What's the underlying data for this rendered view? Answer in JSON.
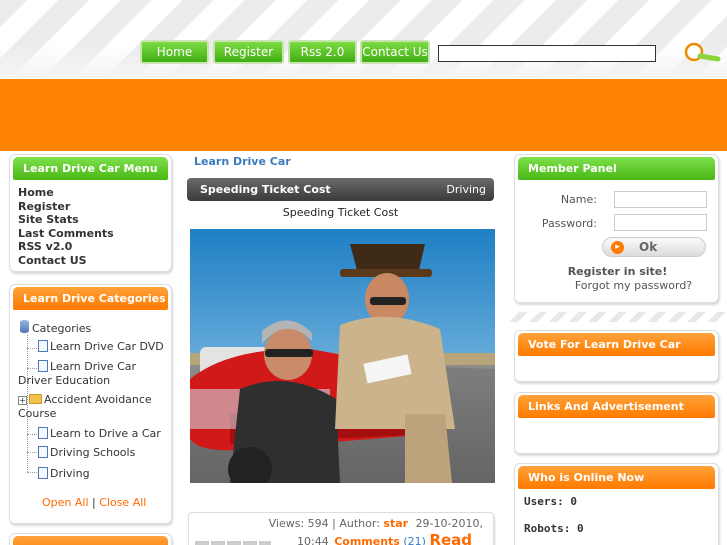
{
  "nav": {
    "home": "Home",
    "register": "Register",
    "rss": "Rss 2.0",
    "contact": "Contact Us",
    "search_value": ""
  },
  "left": {
    "menu_title": "Learn Drive Car Menu",
    "menu_items": [
      "Home",
      "Register",
      "Site Stats",
      "Last Comments",
      "RSS v2.0",
      "Contact US"
    ],
    "cat_title": "Learn Drive Categories",
    "tree_root": "Categories",
    "tree": {
      "dvd": "Learn Drive Car DVD",
      "edu_a": "Learn Drive Car",
      "edu_b": "Driver Education",
      "acc_a": "Accident Avoidance",
      "acc_b": "Course",
      "learn": "Learn to Drive a Car",
      "schools": "Driving Schools",
      "driving": "Driving"
    },
    "open_all": "Open All",
    "sep": "|",
    "close_all": "Close All"
  },
  "center": {
    "breadcrumb": "Learn Drive Car",
    "article_title": "Speeding Ticket Cost",
    "article_category": "Driving",
    "subtitle": "Speeding Ticket Cost",
    "meta_views": "Views: 594 | Author:",
    "meta_author": "star",
    "meta_date": "29-10-2010,",
    "meta_time": "10:44",
    "meta_comments": "Comments",
    "meta_count": "(21)",
    "meta_read": "Read"
  },
  "right": {
    "member_title": "Member Panel",
    "name_label": "Name:",
    "password_label": "Password:",
    "ok_label": "Ok",
    "register_text": "Register in site!",
    "forgot_text": "Forgot my password?",
    "vote_title": "Vote For Learn Drive Car",
    "links_title": "Links And Advertisement",
    "online_title": "Who is Online Now",
    "users": "Users: 0",
    "robots": "Robots: 0"
  },
  "colors": {
    "accent_orange": "#ff8300",
    "accent_green": "#4cba18",
    "link_blue": "#3a7bbf"
  }
}
